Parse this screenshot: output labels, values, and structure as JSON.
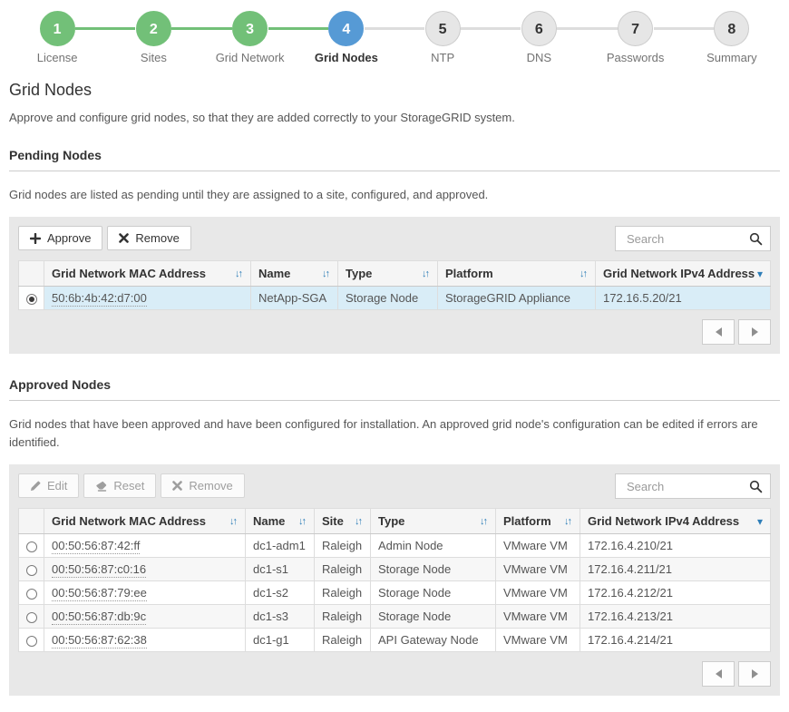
{
  "stepper": {
    "steps": [
      {
        "num": "1",
        "label": "License",
        "state": "done"
      },
      {
        "num": "2",
        "label": "Sites",
        "state": "done"
      },
      {
        "num": "3",
        "label": "Grid Network",
        "state": "done"
      },
      {
        "num": "4",
        "label": "Grid Nodes",
        "state": "active"
      },
      {
        "num": "5",
        "label": "NTP",
        "state": "todo"
      },
      {
        "num": "6",
        "label": "DNS",
        "state": "todo"
      },
      {
        "num": "7",
        "label": "Passwords",
        "state": "todo"
      },
      {
        "num": "8",
        "label": "Summary",
        "state": "todo"
      }
    ]
  },
  "page": {
    "title": "Grid Nodes",
    "description": "Approve and configure grid nodes, so that they are added correctly to your StorageGRID system."
  },
  "pending": {
    "heading": "Pending Nodes",
    "description": "Grid nodes are listed as pending until they are assigned to a site, configured, and approved.",
    "toolbar": {
      "approve_label": "Approve",
      "remove_label": "Remove"
    },
    "search_placeholder": "Search",
    "columns": [
      {
        "label": "Grid Network MAC Address",
        "icon": "sort"
      },
      {
        "label": "Name",
        "icon": "sort"
      },
      {
        "label": "Type",
        "icon": "sort"
      },
      {
        "label": "Platform",
        "icon": "sort"
      },
      {
        "label": "Grid Network IPv4 Address",
        "icon": "chevron-down"
      }
    ],
    "row_keys": [
      "mac",
      "name",
      "type",
      "platform",
      "ip"
    ],
    "rows": [
      {
        "mac": "50:6b:4b:42:d7:00",
        "name": "NetApp-SGA",
        "type": "Storage Node",
        "platform": "StorageGRID Appliance",
        "ip": "172.16.5.20/21",
        "selected": true
      }
    ]
  },
  "approved": {
    "heading": "Approved Nodes",
    "description": "Grid nodes that have been approved and have been configured for installation. An approved grid node's configuration can be edited if errors are identified.",
    "toolbar": {
      "edit_label": "Edit",
      "reset_label": "Reset",
      "remove_label": "Remove"
    },
    "search_placeholder": "Search",
    "columns": [
      {
        "label": "Grid Network MAC Address",
        "icon": "sort"
      },
      {
        "label": "Name",
        "icon": "sort"
      },
      {
        "label": "Site",
        "icon": "sort"
      },
      {
        "label": "Type",
        "icon": "sort"
      },
      {
        "label": "Platform",
        "icon": "sort"
      },
      {
        "label": "Grid Network IPv4 Address",
        "icon": "chevron-down"
      }
    ],
    "row_keys": [
      "mac",
      "name",
      "site",
      "type",
      "platform",
      "ip"
    ],
    "rows": [
      {
        "mac": "00:50:56:87:42:ff",
        "name": "dc1-adm1",
        "site": "Raleigh",
        "type": "Admin Node",
        "platform": "VMware VM",
        "ip": "172.16.4.210/21"
      },
      {
        "mac": "00:50:56:87:c0:16",
        "name": "dc1-s1",
        "site": "Raleigh",
        "type": "Storage Node",
        "platform": "VMware VM",
        "ip": "172.16.4.211/21"
      },
      {
        "mac": "00:50:56:87:79:ee",
        "name": "dc1-s2",
        "site": "Raleigh",
        "type": "Storage Node",
        "platform": "VMware VM",
        "ip": "172.16.4.212/21"
      },
      {
        "mac": "00:50:56:87:db:9c",
        "name": "dc1-s3",
        "site": "Raleigh",
        "type": "Storage Node",
        "platform": "VMware VM",
        "ip": "172.16.4.213/21"
      },
      {
        "mac": "00:50:56:87:62:38",
        "name": "dc1-g1",
        "site": "Raleigh",
        "type": "API Gateway Node",
        "platform": "VMware VM",
        "ip": "172.16.4.214/21"
      }
    ]
  },
  "colors": {
    "step_done": "#72c078",
    "step_active": "#569ad5",
    "step_todo": "#e6e6e6",
    "selected_row": "#d9edf7",
    "sort_icon": "#2e7eb8",
    "panel_bg": "#e8e8e8"
  }
}
